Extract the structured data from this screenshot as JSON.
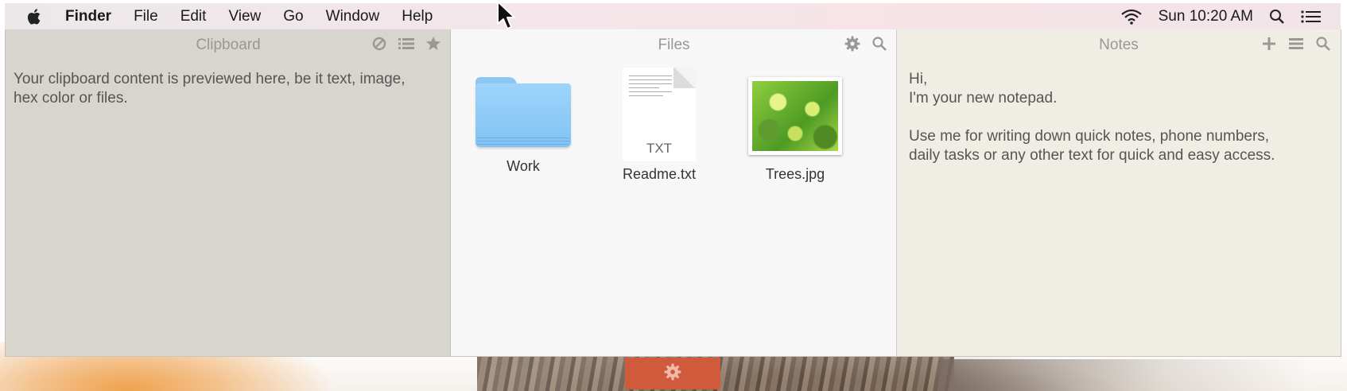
{
  "menubar": {
    "apple_icon": "apple-logo-icon",
    "items": [
      {
        "label": "Finder",
        "bold": true
      },
      {
        "label": "File"
      },
      {
        "label": "Edit"
      },
      {
        "label": "View"
      },
      {
        "label": "Go"
      },
      {
        "label": "Window"
      },
      {
        "label": "Help"
      }
    ],
    "clock": "Sun 10:20 AM",
    "status_icons": [
      "wifi-icon",
      "spotlight-search-icon",
      "notification-center-icon"
    ]
  },
  "clipboard": {
    "title": "Clipboard",
    "icons": [
      "clear-icon",
      "list-icon",
      "star-icon"
    ],
    "text": "Your clipboard content is previewed here, be it text, image, hex color or files."
  },
  "files": {
    "title": "Files",
    "icons": [
      "gear-icon",
      "search-icon"
    ],
    "items": [
      {
        "name": "Work",
        "kind": "folder"
      },
      {
        "name": "Readme.txt",
        "kind": "text",
        "badge": "TXT"
      },
      {
        "name": "Trees.jpg",
        "kind": "image"
      }
    ]
  },
  "notes": {
    "title": "Notes",
    "icons": [
      "add-icon",
      "menu-icon",
      "search-icon"
    ],
    "text": "Hi,\nI'm your new notepad.\n\nUse me for writing down quick notes, phone numbers,\ndaily tasks or any other text for quick and easy access."
  },
  "colors": {
    "clipboard_bg": "#d8d5cf",
    "files_bg": "#f7f7f7",
    "notes_bg": "#f0ede5",
    "dock_tab": "#d05a3c"
  }
}
